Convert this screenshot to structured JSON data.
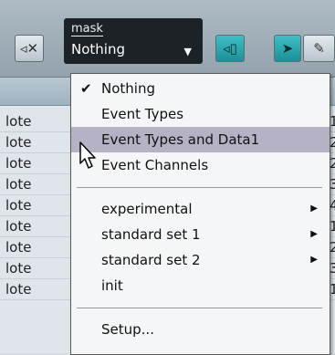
{
  "toolbar": {
    "mask_label": "mask",
    "mask_value": "Nothing"
  },
  "list_rows": [
    {
      "left": "lote",
      "right": "1"
    },
    {
      "left": "lote",
      "right": "2"
    },
    {
      "left": "lote",
      "right": "2"
    },
    {
      "left": "lote",
      "right": "3"
    },
    {
      "left": "lote",
      "right": "4"
    },
    {
      "left": "lote",
      "right": "1"
    },
    {
      "left": "lote",
      "right": "2"
    },
    {
      "left": "lote",
      "right": "3"
    },
    {
      "left": "lote",
      "right": "1"
    }
  ],
  "menu": {
    "items": [
      {
        "label": "Nothing",
        "checked": true
      },
      {
        "label": "Event Types"
      },
      {
        "label": "Event Types and Data1",
        "highlighted": true
      },
      {
        "label": "Event Channels"
      },
      {
        "label": "experimental",
        "submenu": true
      },
      {
        "label": "standard set 1",
        "submenu": true
      },
      {
        "label": "standard set 2",
        "submenu": true
      },
      {
        "label": "init"
      },
      {
        "label": "Setup..."
      }
    ]
  },
  "colors": {
    "highlight": "#b5b2c6",
    "teal_button": "#2aa5ad",
    "mask_box": "#1d2226"
  },
  "icons": {
    "check": "checkmark-icon",
    "submenu": "submenu-arrow-icon",
    "cursor": "mouse-pointer-icon"
  }
}
